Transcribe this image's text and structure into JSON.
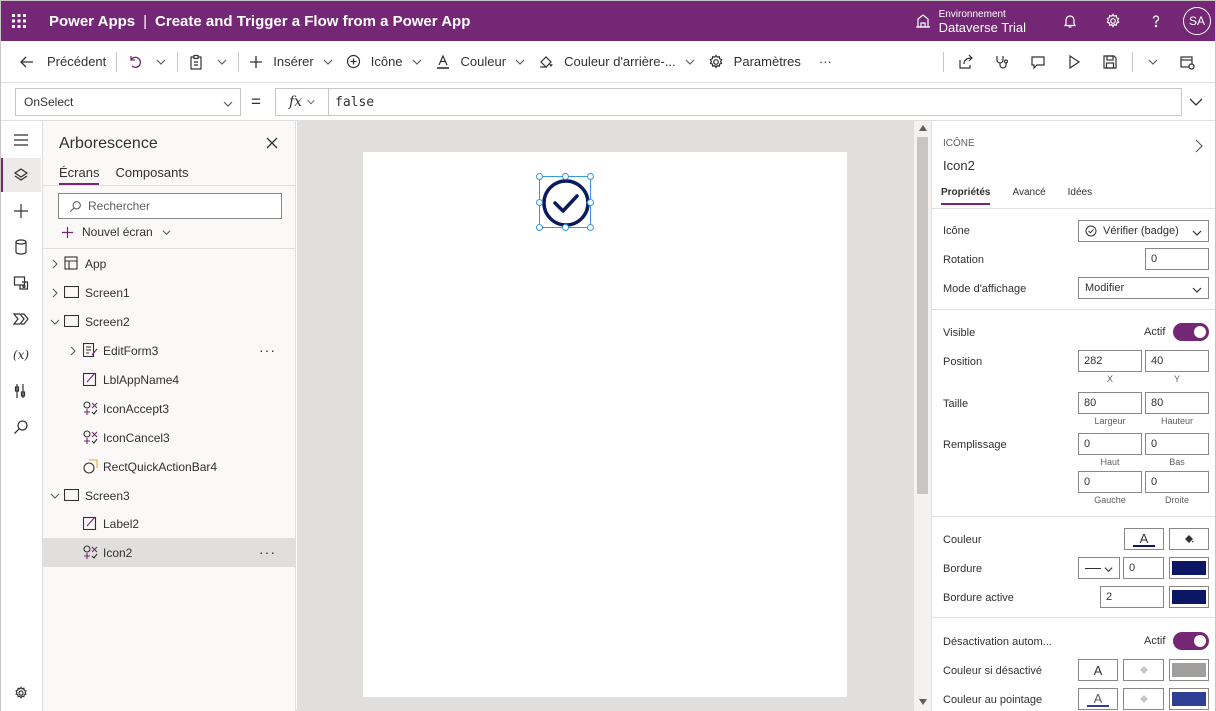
{
  "topbar": {
    "app_name": "Power Apps",
    "separator": "|",
    "document_title": "Create and Trigger a Flow from a Power App",
    "environment_label": "Environnement",
    "environment_name": "Dataverse Trial",
    "user_initials": "SA"
  },
  "commandbar": {
    "back": "Précédent",
    "insert": "Insérer",
    "icon": "Icône",
    "color": "Couleur",
    "background_color": "Couleur d'arrière-...",
    "settings": "Paramètres",
    "more": "···"
  },
  "formula": {
    "property": "OnSelect",
    "equals": "=",
    "fx": "fx",
    "value": "false"
  },
  "tree": {
    "title": "Arborescence",
    "tabs": [
      "Écrans",
      "Composants"
    ],
    "search_placeholder": "Rechercher",
    "new_screen": "Nouvel écran",
    "nodes": [
      {
        "label": "App",
        "icon": "app-icon"
      },
      {
        "label": "Screen1",
        "icon": "screen-icon"
      },
      {
        "label": "Screen2",
        "icon": "screen-icon"
      },
      {
        "label": "EditForm3",
        "icon": "form-icon"
      },
      {
        "label": "LblAppName4",
        "icon": "label-icon"
      },
      {
        "label": "IconAccept3",
        "icon": "icon-control-icon"
      },
      {
        "label": "IconCancel3",
        "icon": "icon-control-icon"
      },
      {
        "label": "RectQuickActionBar4",
        "icon": "rectangle-icon"
      },
      {
        "label": "Screen3",
        "icon": "screen-icon"
      },
      {
        "label": "Label2",
        "icon": "label-icon"
      },
      {
        "label": "Icon2",
        "icon": "icon-control-icon"
      }
    ],
    "more": "···"
  },
  "properties": {
    "type": "ICÔNE",
    "name": "Icon2",
    "tabs": [
      "Propriétés",
      "Avancé",
      "Idées"
    ],
    "icon_label": "Icône",
    "icon_value": "Vérifier (badge)",
    "rotation_label": "Rotation",
    "rotation_value": "0",
    "display_mode_label": "Mode d'affichage",
    "display_mode_value": "Modifier",
    "visible_label": "Visible",
    "visible_state": "Actif",
    "position_label": "Position",
    "position_x": "282",
    "position_y": "40",
    "x_label": "X",
    "y_label": "Y",
    "size_label": "Taille",
    "width": "80",
    "height": "80",
    "width_label": "Largeur",
    "height_label": "Hauteur",
    "padding_label": "Remplissage",
    "padding_top": "0",
    "padding_bottom": "0",
    "padding_left": "0",
    "padding_right": "0",
    "top_label": "Haut",
    "bottom_label": "Bas",
    "left_label": "Gauche",
    "right_label": "Droite",
    "color_label": "Couleur",
    "border_label": "Bordure",
    "border_value": "0",
    "focused_border_label": "Bordure active",
    "focused_border_value": "2",
    "auto_disable_label": "Désactivation autom...",
    "auto_disable_state": "Actif",
    "disabled_color_label": "Couleur si désactivé",
    "hover_color_label": "Couleur au pointage",
    "font_glyph": "A"
  },
  "colors": {
    "brand": "#742774",
    "icon_stroke": "#0b1b5c",
    "border_swatch": "#0b1764",
    "disabled_swatch": "#a19f9d",
    "hover_swatch": "#2f3f94",
    "selection": "#3a96dd"
  }
}
